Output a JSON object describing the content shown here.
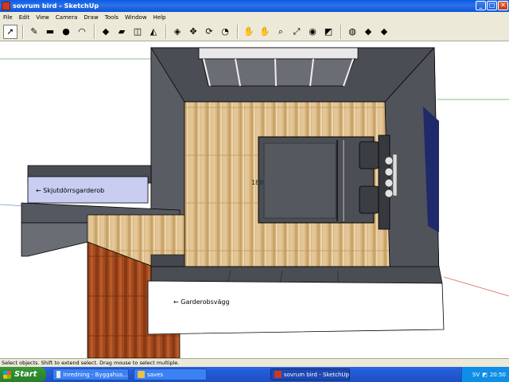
{
  "window": {
    "title": "sovrum bird - SketchUp",
    "buttons": {
      "minimize": "_",
      "maximize": "□",
      "close": "✕"
    }
  },
  "menu": [
    "File",
    "Edit",
    "View",
    "Camera",
    "Draw",
    "Tools",
    "Window",
    "Help"
  ],
  "toolbar": [
    {
      "name": "select-tool",
      "glyph": "➚",
      "selected": true
    },
    {
      "name": "pencil-tool",
      "glyph": "✎"
    },
    {
      "name": "rectangle-tool",
      "glyph": "▬"
    },
    {
      "name": "circle-tool",
      "glyph": "●"
    },
    {
      "name": "arc-tool",
      "glyph": "◠"
    },
    {
      "name": "make-component-tool",
      "glyph": "◆"
    },
    {
      "name": "eraser-tool",
      "glyph": "▰"
    },
    {
      "name": "tape-measure-tool",
      "glyph": "◫"
    },
    {
      "name": "paint-bucket-tool",
      "glyph": "◭"
    },
    {
      "name": "push-pull-tool",
      "glyph": "◈"
    },
    {
      "name": "move-tool",
      "glyph": "✥"
    },
    {
      "name": "rotate-tool",
      "glyph": "⟳"
    },
    {
      "name": "offset-tool",
      "glyph": "◔"
    },
    {
      "name": "orbit-tool",
      "glyph": "✋"
    },
    {
      "name": "pan-tool",
      "glyph": "✋"
    },
    {
      "name": "zoom-tool",
      "glyph": "⌕"
    },
    {
      "name": "zoom-extents-tool",
      "glyph": "⤢"
    },
    {
      "name": "previous-view-tool",
      "glyph": "◉"
    },
    {
      "name": "next-view-tool",
      "glyph": "◩"
    },
    {
      "name": "3d-warehouse-tool",
      "glyph": "◍"
    },
    {
      "name": "get-models-tool",
      "glyph": "◆"
    },
    {
      "name": "share-model-tool",
      "glyph": "◆"
    }
  ],
  "viewport": {
    "labels": {
      "skjut": "← Skjutdörrsgarderob",
      "garde": "← Garderobsvägg",
      "dimension": "180"
    }
  },
  "status": "Select objects. Shift to extend select. Drag mouse to select multiple.",
  "taskbar": {
    "start": "Start",
    "tasks": [
      {
        "label": "Inredning - Byggahus...",
        "active": false,
        "color": "#e9e9e9"
      },
      {
        "label": "saves",
        "active": false,
        "color": "#e6c34b"
      },
      {
        "label": "sovrum bird - SketchUp",
        "active": true,
        "color": "#c53b2a"
      }
    ],
    "tray": {
      "lang": "SV",
      "time": "20:50"
    }
  }
}
